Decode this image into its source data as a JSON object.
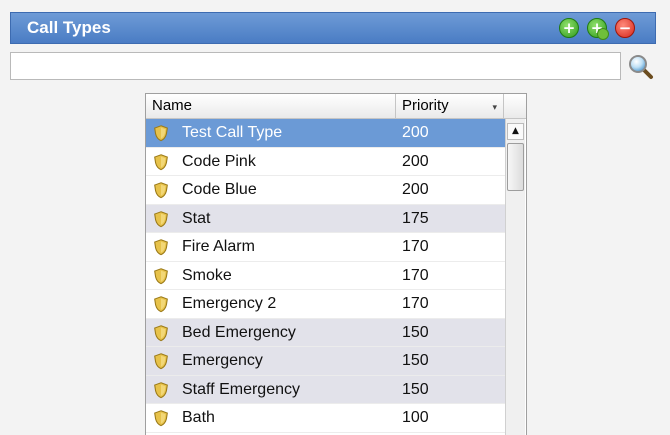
{
  "panel": {
    "title": "Call Types",
    "buttons": {
      "add": "+",
      "remove": "−"
    }
  },
  "search": {
    "value": "",
    "placeholder": ""
  },
  "grid": {
    "columns": {
      "name": "Name",
      "priority": "Priority"
    },
    "sort_indicator": "▾",
    "rows": [
      {
        "name": "Test Call Type",
        "priority": "200"
      },
      {
        "name": "Code Pink",
        "priority": "200"
      },
      {
        "name": "Code Blue",
        "priority": "200"
      },
      {
        "name": "Stat",
        "priority": "175"
      },
      {
        "name": "Fire Alarm",
        "priority": "170"
      },
      {
        "name": "Smoke",
        "priority": "170"
      },
      {
        "name": "Emergency 2",
        "priority": "170"
      },
      {
        "name": "Bed Emergency",
        "priority": "150"
      },
      {
        "name": "Emergency",
        "priority": "150"
      },
      {
        "name": "Staff Emergency",
        "priority": "150"
      },
      {
        "name": "Bath",
        "priority": "100"
      }
    ]
  },
  "scrollbar": {
    "up_arrow": "▲"
  },
  "colors": {
    "header_blue": "#4a7cc4",
    "selected_row": "#6b9ad6",
    "alt_row": "#e2e2ea",
    "add_green": "#2f9a1e",
    "remove_red": "#d4261a"
  }
}
